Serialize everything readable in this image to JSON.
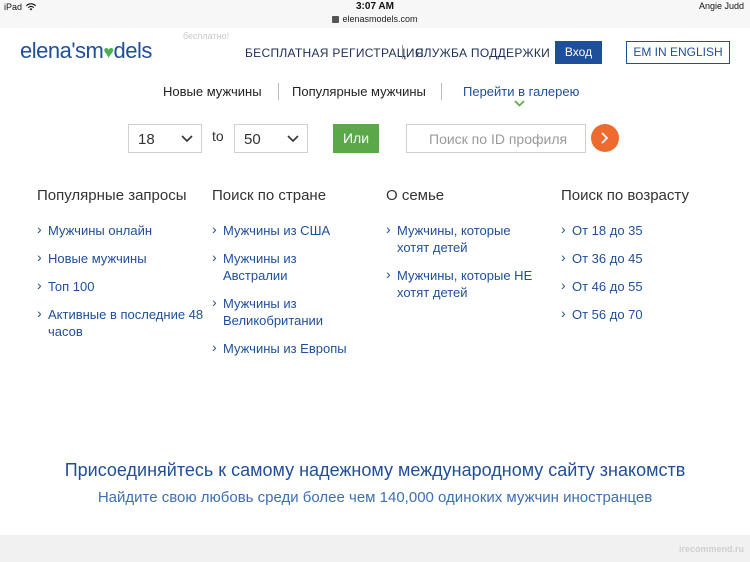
{
  "status": {
    "device": "iPad",
    "time": "3:07 AM",
    "user": "Angie Judd",
    "url": "elenasmodels.com",
    "ghost_text": "бесплатно!"
  },
  "header": {
    "logo_part1": "elena's",
    "logo_part2": "m",
    "logo_part3": "dels",
    "register": "БЕСПЛАТНАЯ РЕГИСТРАЦИЯ",
    "support": "СЛУЖБА ПОДДЕРЖКИ",
    "login": "Вход",
    "lang": "EM IN ENGLISH"
  },
  "nav": {
    "new_men": "Новые мужчины",
    "popular_men": "Популярные мужчины",
    "gallery": "Перейти в галерею"
  },
  "filter": {
    "age_from": "18",
    "to_label": "to",
    "age_to": "50",
    "or_button": "Или",
    "search_placeholder": "Поиск по ID профиля"
  },
  "columns": [
    {
      "title": "Популярные запросы",
      "links": [
        "Мужчины онлайн",
        "Новые мужчины",
        "Топ 100",
        "Активные в последние 48 часов"
      ]
    },
    {
      "title": "Поиск по стране",
      "links": [
        "Мужчины из США",
        "Мужчины из Австралии",
        "Мужчины из Великобритании",
        "Мужчины из Европы"
      ]
    },
    {
      "title": "О семье",
      "links": [
        "Мужчины, которые хотят детей",
        "Мужчины, которые НЕ хотят детей"
      ]
    },
    {
      "title": "Поиск по возрасту",
      "links": [
        "От 18 до 35",
        "От 36 до 45",
        "От 46 до 55",
        "От 56 до 70"
      ]
    }
  ],
  "tagline": {
    "main": "Присоединяйтесь к самому надежному международному сайту знакомств",
    "sub": "Найдите свою любовь среди более чем 140,000 одиноких мужчин иностранцев"
  },
  "watermark": "irecommend.ru",
  "colors": {
    "brand_blue": "#1f4e9a",
    "green": "#5aa84a",
    "orange": "#ee6a2f"
  }
}
